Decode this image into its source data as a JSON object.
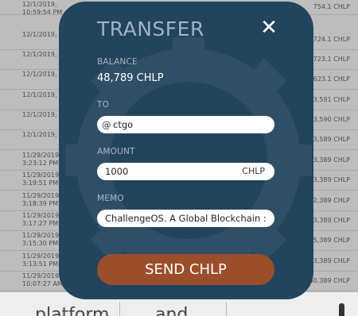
{
  "background_list": {
    "rows": [
      {
        "date": "12/1/2019, 10:59:54 PM",
        "amount": "754.1 CHLP"
      },
      {
        "date": "12/1/2019, PM",
        "amount": "724.1 CHLP"
      },
      {
        "date": "12/1/2019, PM",
        "amount": "723.1 CHLP"
      },
      {
        "date": "12/1/2019, PM",
        "amount": "623.1 CHLP"
      },
      {
        "date": "12/1/2019, PM",
        "amount": "3,591 CHLP"
      },
      {
        "date": "12/1/2019, PM",
        "amount": "3,590 CHLP"
      },
      {
        "date": "12/1/2019, PM",
        "amount": "3,589 CHLP"
      },
      {
        "date": "11/29/2019, 3:23:12 PM",
        "amount": "3,389 CHLP"
      },
      {
        "date": "11/29/2019, 3:19:51 PM",
        "amount": "3,389 CHLP"
      },
      {
        "date": "11/29/2019, 3:18:39 PM",
        "amount": "2,389 CHLP"
      },
      {
        "date": "11/29/2019, 3:17:27 PM",
        "amount": "3,389 CHLP"
      },
      {
        "date": "11/29/2019, 3:15:30 PM",
        "amount": "5,389 CHLP"
      },
      {
        "date": "11/29/2019, 3:13:51 PM",
        "amount": "3,389 CHLP"
      },
      {
        "date": "11/29/2019, 10:07:27 AM",
        "amount": "30,389 CHLP"
      }
    ]
  },
  "tabbar": {
    "tabs": [
      "platform",
      "and"
    ]
  },
  "modal": {
    "title": "TRANSFER",
    "close_glyph": "✕",
    "balance_label": "BALANCE",
    "balance_value": "48,789 CHLP",
    "to_label": "TO",
    "to_prefix": "@",
    "to_value": "ctgo",
    "amount_label": "AMOUNT",
    "amount_value": "1000",
    "amount_unit": "CHLP",
    "memo_label": "MEMO",
    "memo_value": "ChallengeOS. A Global Blockchain :",
    "send_label": "SEND CHLP"
  },
  "colors": {
    "modal_bg": "#23445d",
    "send_button": "#9b4e2a",
    "title": "#9fb4c6"
  }
}
